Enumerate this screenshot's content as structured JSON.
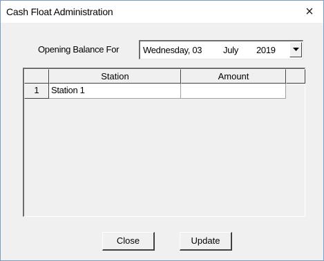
{
  "window": {
    "title": "Cash Float Administration",
    "close_glyph": "×"
  },
  "opening_balance": {
    "label": "Opening Balance For",
    "date": {
      "weekday": "Wednesday, 03",
      "month": "July",
      "year": "2019"
    }
  },
  "grid": {
    "columns": [
      "",
      "Station",
      "Amount",
      ""
    ],
    "rows": [
      {
        "num": "1",
        "station": "Station 1",
        "amount": ""
      }
    ]
  },
  "buttons": {
    "close_label": "Close",
    "update_label": "Update"
  }
}
